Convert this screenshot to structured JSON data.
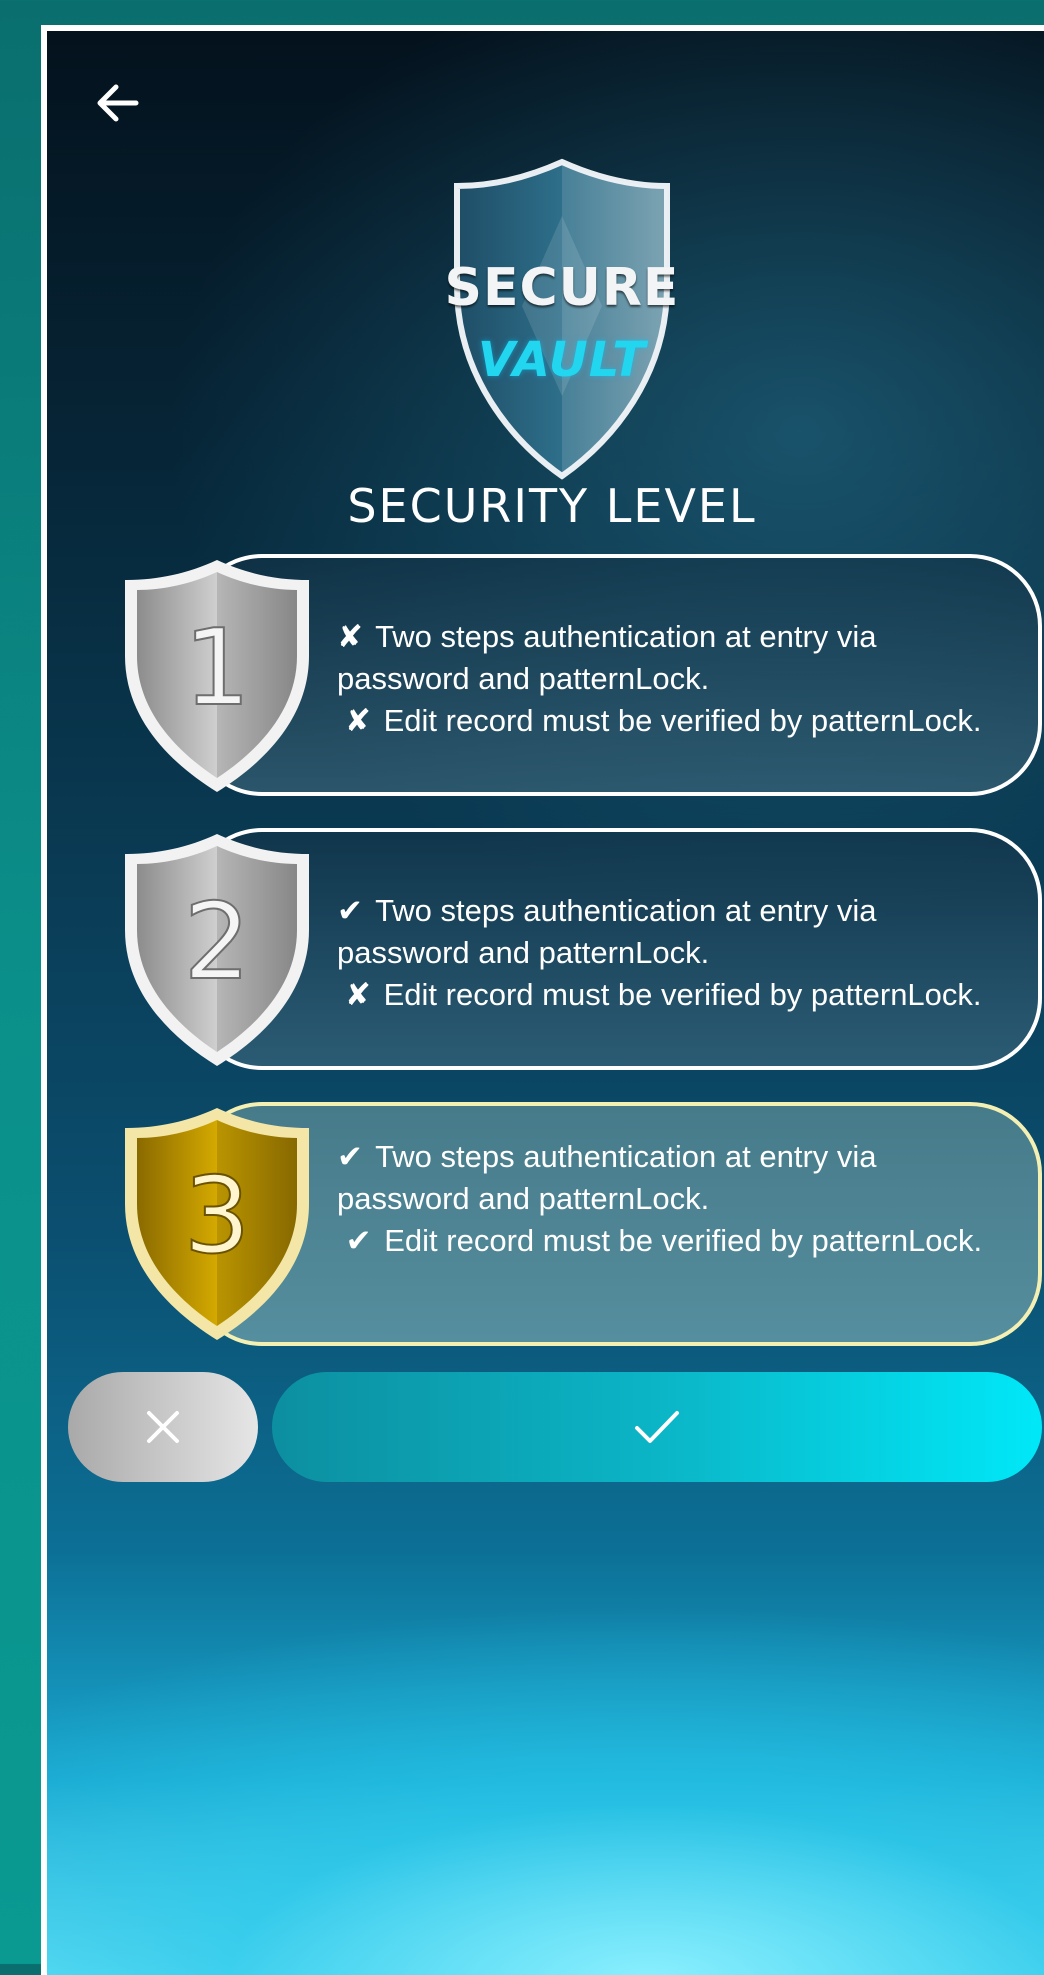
{
  "app": {
    "logo": {
      "line1": "SECURE",
      "line2": "VAULT"
    },
    "title": "SECURITY LEVEL"
  },
  "levels": [
    {
      "number": "1",
      "entry_mark": "✘",
      "entry_text": "Two steps authentication at entry via password and patternLock.",
      "edit_mark": "✘",
      "edit_text": "Edit record must be verified by patternLock.",
      "selected": false
    },
    {
      "number": "2",
      "entry_mark": "✔",
      "entry_text": "Two steps authentication at entry via password and patternLock.",
      "edit_mark": "✘",
      "edit_text": "Edit record must be verified by patternLock.",
      "selected": false
    },
    {
      "number": "3",
      "entry_mark": "✔",
      "entry_text": "Two steps authentication at entry via password and patternLock.",
      "edit_mark": "✔",
      "edit_text": "Edit record must be verified by patternLock.",
      "selected": true
    }
  ],
  "icons": {
    "back": "arrow-left-icon",
    "cancel": "close-icon",
    "confirm": "check-icon"
  },
  "colors": {
    "accent": "#22d6f0",
    "confirm": "#00e8f8",
    "gold": "#d4a900",
    "silver": "#bdbdbd"
  }
}
